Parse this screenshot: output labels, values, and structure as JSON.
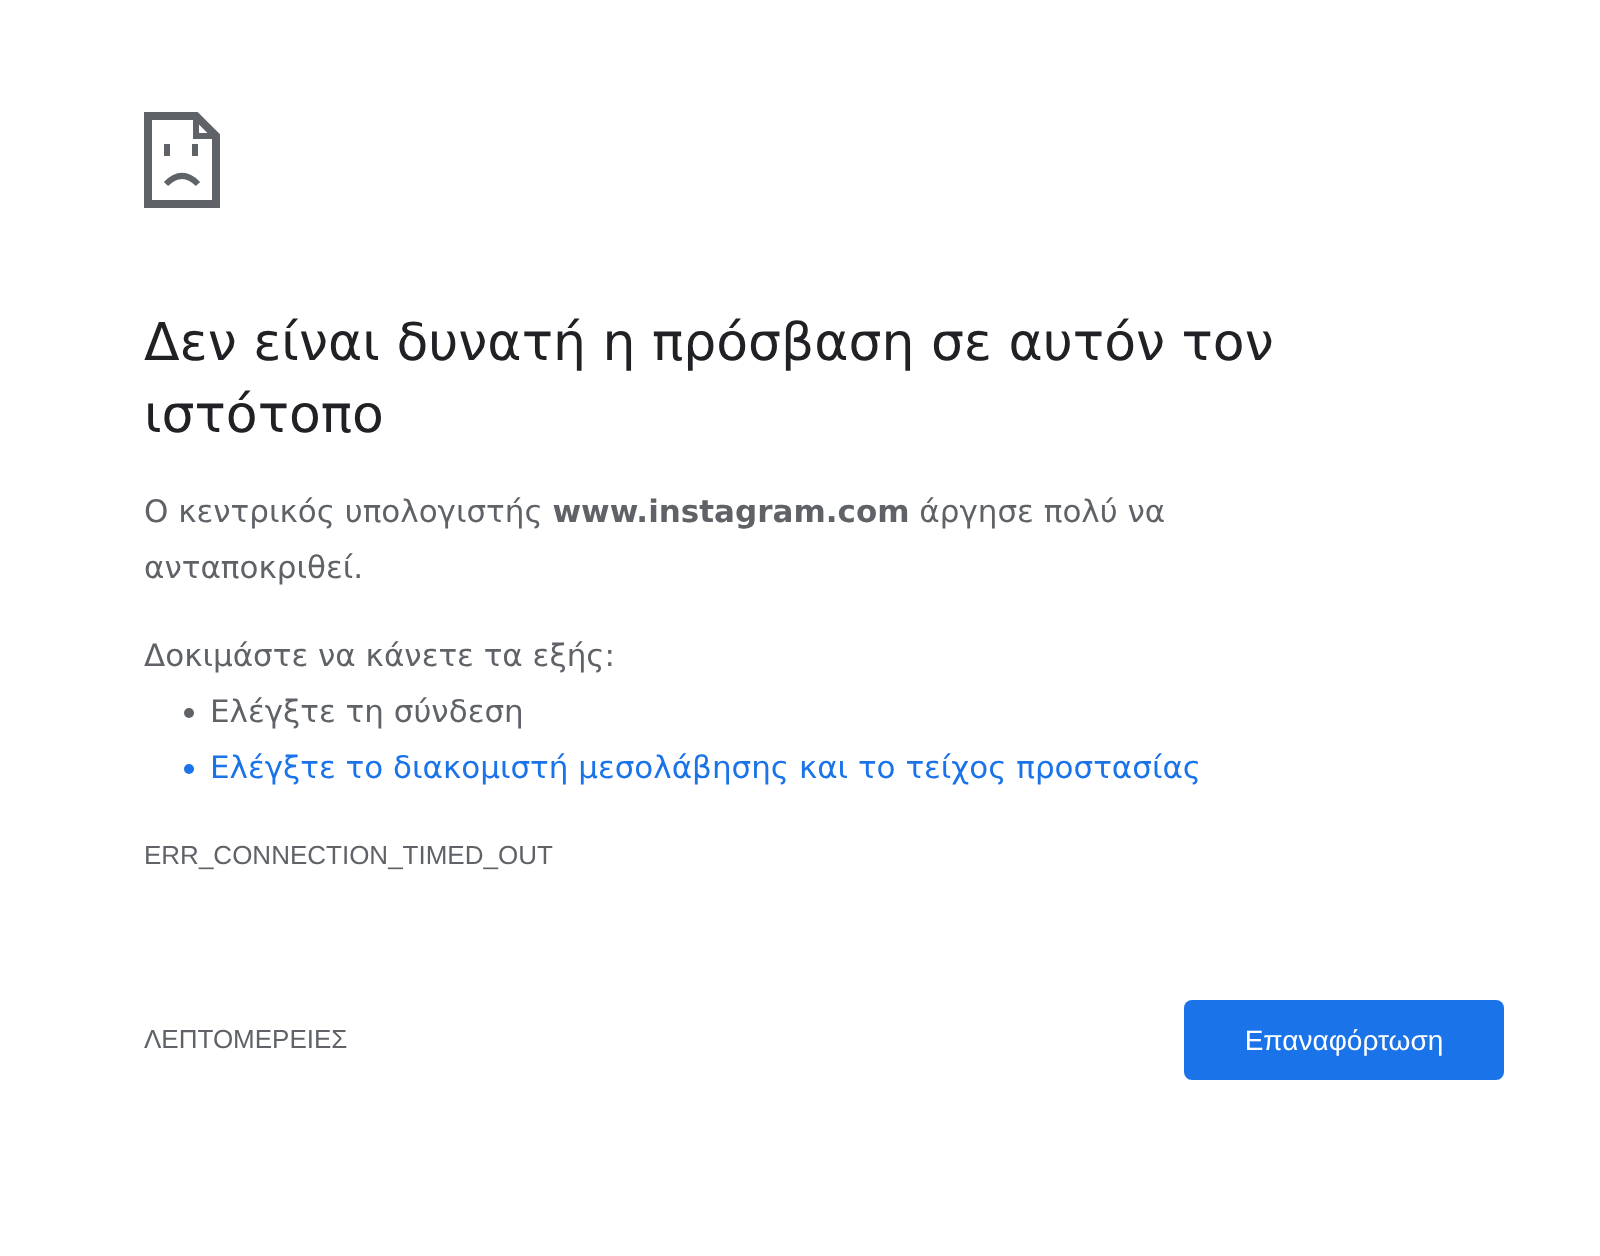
{
  "heading": "Δεν είναι δυνατή η πρόσβαση σε αυτόν τον ιστότοπο",
  "summary": "Ο κεντρικός υπολογιστής **www.instagram.com** άργησε πολύ να ανταποκριθεί.",
  "suggestions_intro": "Δοκιμάστε να κάνετε τα εξής:",
  "suggestions": [
    {
      "kind": "text",
      "text": "Ελέγξτε τη σύνδεση"
    },
    {
      "kind": "link",
      "text": "Ελέγξτε το διακομιστή μεσολάβησης και το τείχος προστασίας"
    }
  ],
  "error_code": "ERR_CONNECTION_TIMED_OUT",
  "details_button": "ΛΕΠΤΟΜΕΡΕΙΕΣ",
  "reload_button": "Επαναφόρτωση"
}
